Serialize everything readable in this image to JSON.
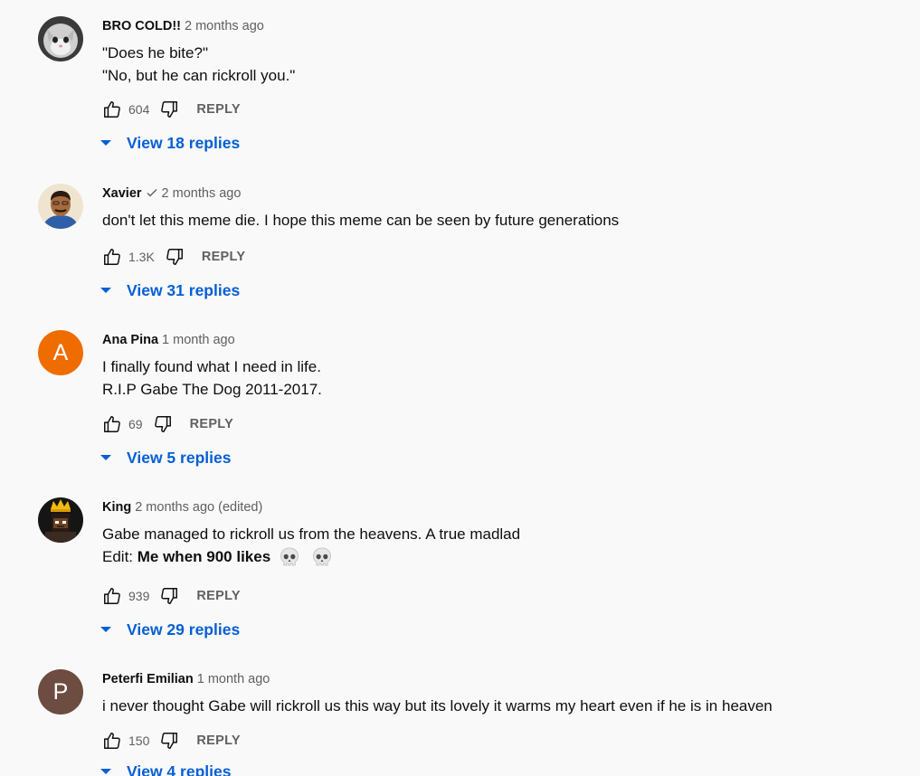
{
  "colors": {
    "background": "#f9f9f9",
    "link_blue": "#065fd4",
    "muted_text": "#606060",
    "avatar_ana": "#ef6c00",
    "avatar_peterfi": "#6d4c41"
  },
  "comments": [
    {
      "author": "BRO COLD!!",
      "time": "2 months ago",
      "text_lines": [
        "\"Does he bite?\"",
        "\"No, but he can rickroll you.\""
      ],
      "likes": "604",
      "reply_label": "REPLY",
      "replies_label": "View 18 replies",
      "avatar_icon": "cat-avatar"
    },
    {
      "author": "Xavier",
      "time": "2 months ago",
      "text_lines": [
        "don't let this meme die. I hope this meme can be seen by future generations"
      ],
      "likes": "1.3K",
      "reply_label": "REPLY",
      "replies_label": "View 31 replies",
      "avatar_icon": "man-portrait-avatar"
    },
    {
      "author": "Ana Pina",
      "time": "1 month ago",
      "text_lines": [
        "I finally found what I need in life.",
        "R.I.P Gabe The Dog 2011-2017."
      ],
      "likes": "69",
      "reply_label": "REPLY",
      "replies_label": "View 5 replies",
      "avatar_letter": "A"
    },
    {
      "author": "King",
      "time": "2 months ago (edited)",
      "text_lines": [
        "Gabe managed to rickroll us from the heavens. A true madlad"
      ],
      "edit_prefix": "Edit: ",
      "edit_text": "Me when 900 likes",
      "edit_emoji": [
        "skull-emoji",
        "skull-emoji"
      ],
      "likes": "939",
      "reply_label": "REPLY",
      "replies_label": "View 29 replies",
      "avatar_icon": "pixel-king-avatar"
    },
    {
      "author": "Peterfi Emilian",
      "time": "1 month ago",
      "text_lines": [
        "i never thought Gabe will rickroll us this way but its lovely it warms my heart even if he is in heaven"
      ],
      "likes": "150",
      "reply_label": "REPLY",
      "replies_label": "View 4 replies",
      "avatar_letter": "P"
    }
  ]
}
